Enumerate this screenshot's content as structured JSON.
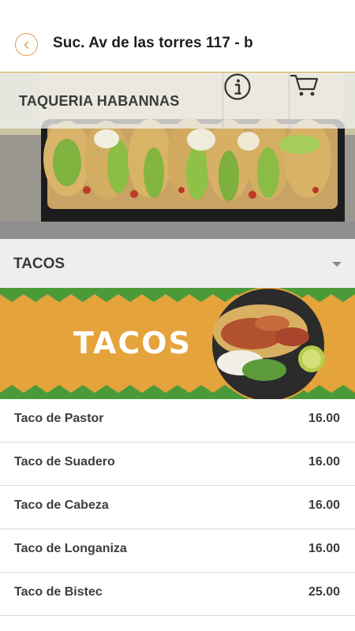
{
  "header": {
    "branch_title": "Suc. Av de las torres 117 - b",
    "back_icon": "chevron-left-icon"
  },
  "hero": {
    "store_name": "TAQUERIA HABANNAS",
    "info_icon": "info-icon",
    "cart_icon": "cart-icon"
  },
  "category": {
    "label": "TACOS",
    "caret_icon": "caret-down-icon"
  },
  "banner": {
    "text": "TACOS"
  },
  "menu": {
    "items": [
      {
        "name": "Taco de Pastor",
        "price": "16.00"
      },
      {
        "name": "Taco de Suadero",
        "price": "16.00"
      },
      {
        "name": "Taco de Cabeza",
        "price": "16.00"
      },
      {
        "name": "Taco de Longaniza",
        "price": "16.00"
      },
      {
        "name": "Taco de Bistec",
        "price": "25.00"
      }
    ]
  },
  "colors": {
    "accent_gold": "#d9a64d",
    "banner_orange": "#e5a33b",
    "banner_green": "#4b9a3a"
  }
}
